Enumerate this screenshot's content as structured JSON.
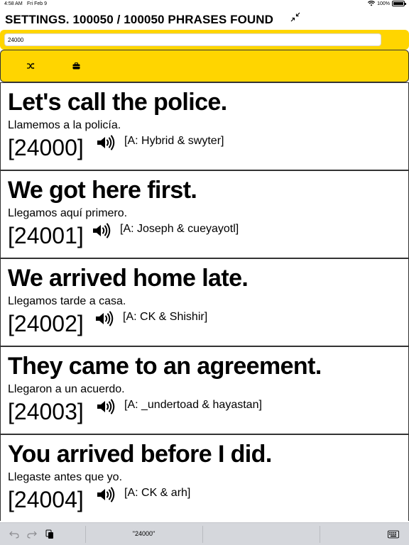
{
  "status_bar": {
    "time": "4:58 AM",
    "date": "Fri Feb 9",
    "battery": "100%",
    "battery_level": 1.0
  },
  "header": {
    "title": "SETTINGS. 100050 / 100050 PHRASES FOUND",
    "collapse_icon": "collapse-arrows-icon"
  },
  "search": {
    "value": "24000",
    "background": "#FFD500"
  },
  "toolbar": {
    "shuffle_icon": "shuffle-icon",
    "briefcase_icon": "briefcase-icon"
  },
  "phrases": [
    {
      "english": "Let's call the police.",
      "spanish": "Llamemos a la policía.",
      "number": "[24000]",
      "attribution": "[A: Hybrid & swyter]"
    },
    {
      "english": "We got here first.",
      "spanish": "Llegamos aquí primero.",
      "number": "[24001]",
      "attribution": "[A: Joseph & cueyayotl]"
    },
    {
      "english": "We arrived home late.",
      "spanish": "Llegamos tarde a casa.",
      "number": "[24002]",
      "attribution": "[A: CK & Shishir]"
    },
    {
      "english": "They came to an agreement.",
      "spanish": "Llegaron a un acuerdo.",
      "number": "[24003]",
      "attribution": "[A: _undertoad & hayastan]"
    },
    {
      "english": "You arrived before I did.",
      "spanish": "Llegaste antes que yo.",
      "number": "[24004]",
      "attribution": "[A: CK & arh]"
    }
  ],
  "keyboard_bar": {
    "suggestion": "\"24000\""
  }
}
